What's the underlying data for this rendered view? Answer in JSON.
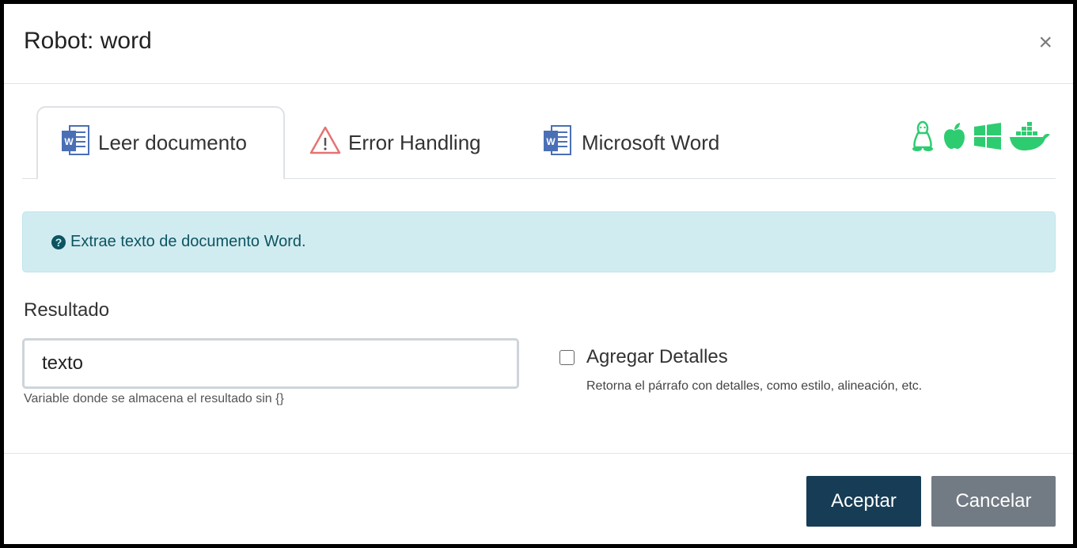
{
  "dialog": {
    "title": "Robot: word",
    "close_label": "×"
  },
  "tabs": [
    {
      "label": "Leer documento",
      "icon": "word-icon",
      "active": true
    },
    {
      "label": "Error Handling",
      "icon": "warning-icon",
      "active": false
    },
    {
      "label": "Microsoft Word",
      "icon": "word-icon",
      "active": false
    }
  ],
  "platform_icons": [
    "linux-icon",
    "apple-icon",
    "windows-icon",
    "docker-icon"
  ],
  "info": {
    "text": "Extrae texto de documento Word."
  },
  "result": {
    "label": "Resultado",
    "value": "texto",
    "help": "Variable donde se almacena el resultado sin {}"
  },
  "details": {
    "label": "Agregar Detalles",
    "checked": false,
    "help": "Retorna el párrafo con detalles, como estilo, alineación, etc."
  },
  "footer": {
    "accept_label": "Aceptar",
    "cancel_label": "Cancelar"
  },
  "colors": {
    "platform_green": "#2ecc71",
    "accept_bg": "#173c55",
    "cancel_bg": "#727b84",
    "alert_bg": "#d1ecf1",
    "word_blue": "#4a6fb5",
    "warning_red": "#e57373"
  }
}
